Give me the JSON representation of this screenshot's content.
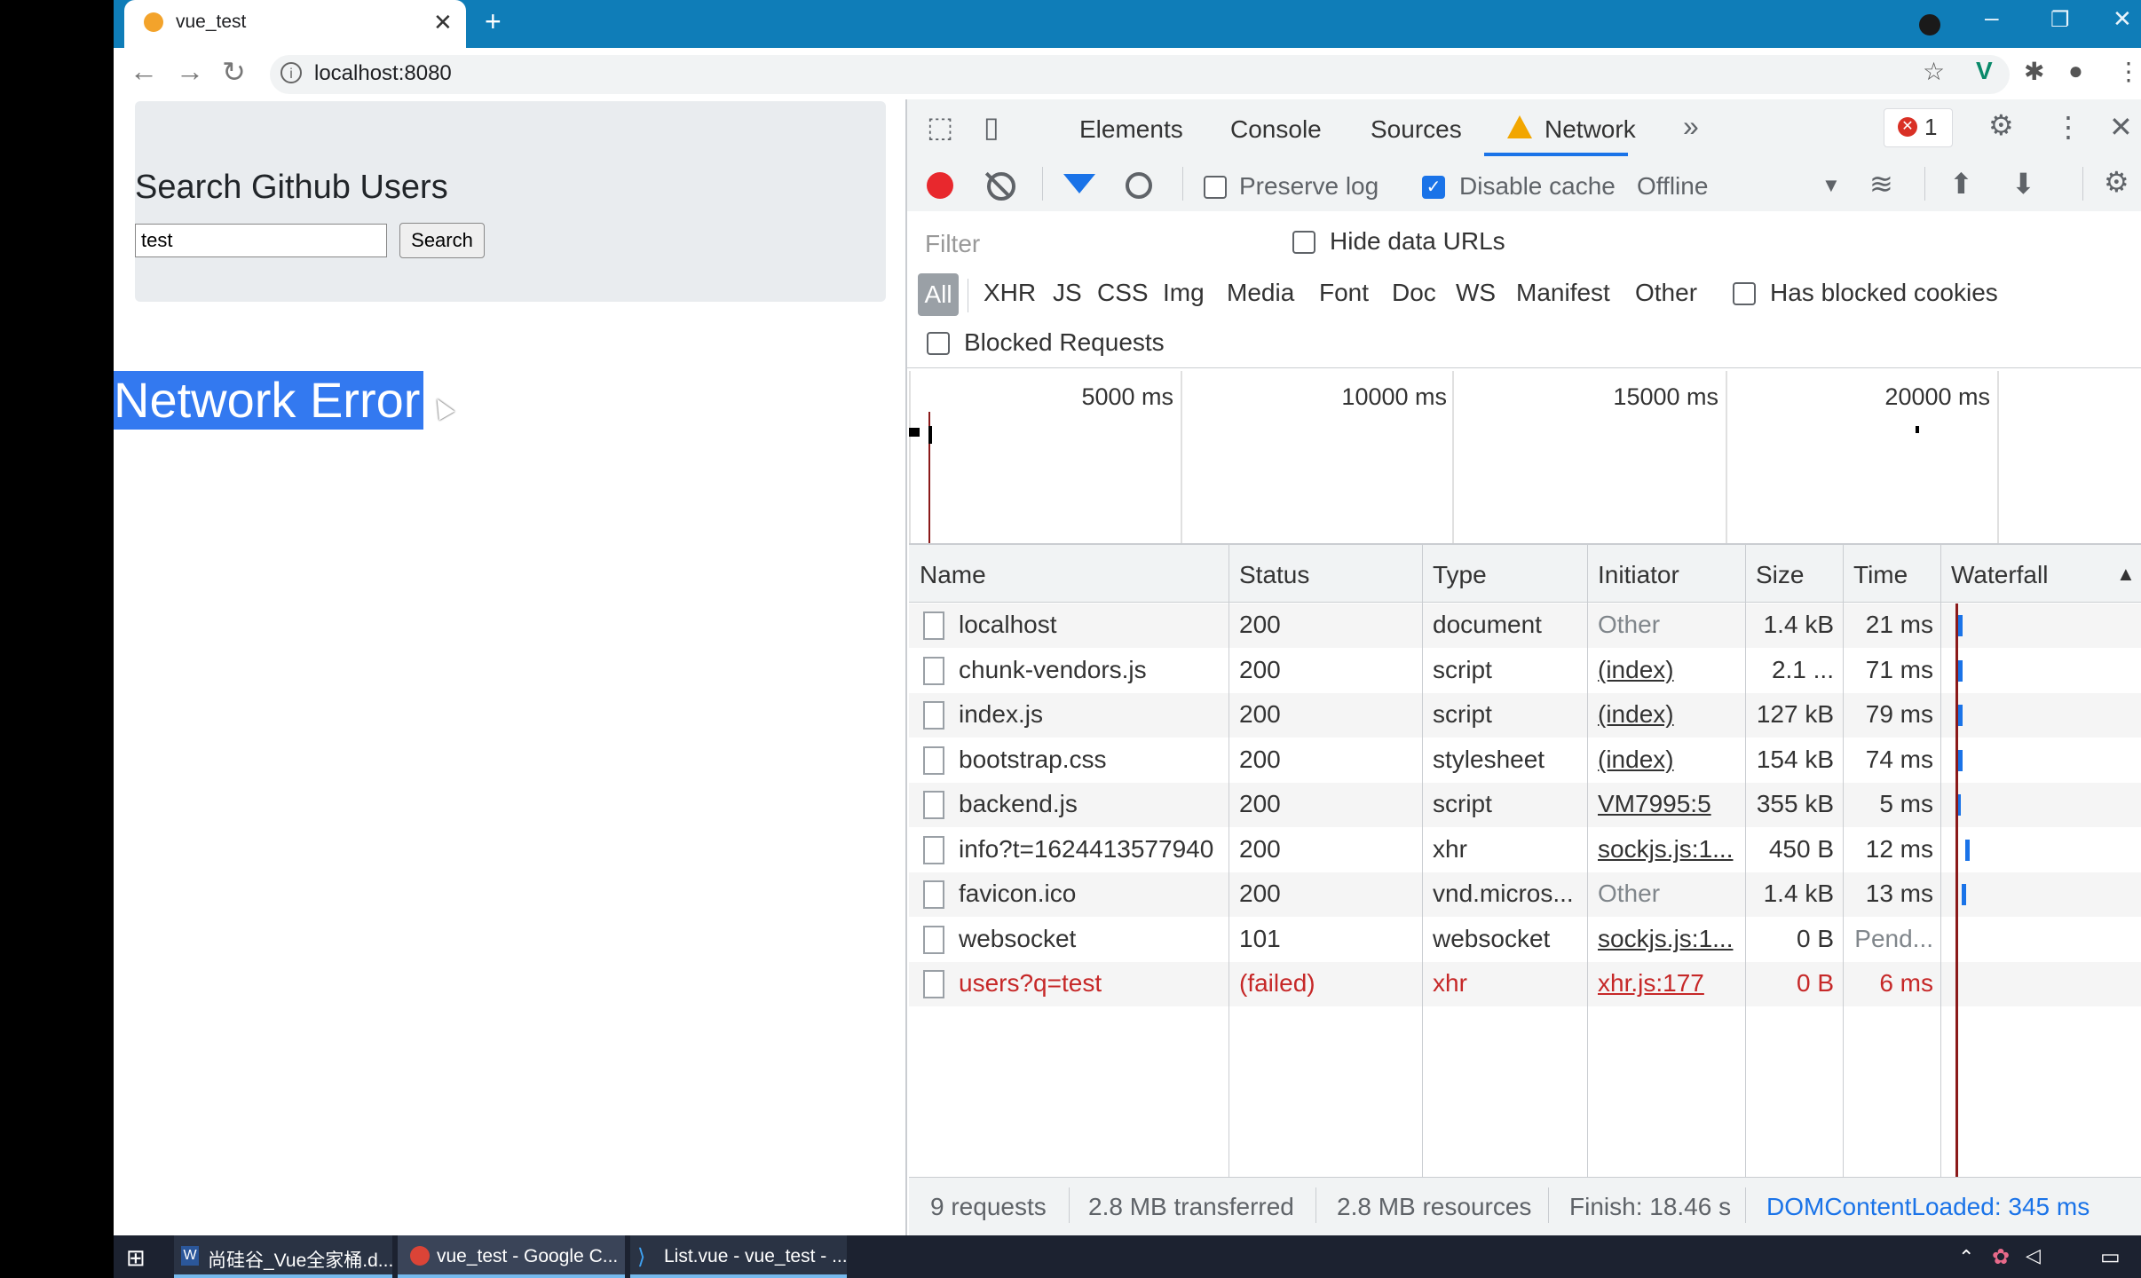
{
  "browser": {
    "tab_title": "vue_test",
    "url": "localhost:8080"
  },
  "page": {
    "heading": "Search Github Users",
    "search_value": "test",
    "search_button": "Search",
    "error_message": "Network Error"
  },
  "devtools": {
    "tabs": [
      "Elements",
      "Console",
      "Sources",
      "Network"
    ],
    "error_count": "1",
    "toolbar": {
      "preserve_log": "Preserve log",
      "preserve_log_checked": false,
      "disable_cache": "Disable cache",
      "disable_cache_checked": true,
      "throttling": "Offline"
    },
    "filter_placeholder": "Filter",
    "hide_data_urls": "Hide data URLs",
    "types": [
      "All",
      "XHR",
      "JS",
      "CSS",
      "Img",
      "Media",
      "Font",
      "Doc",
      "WS",
      "Manifest",
      "Other"
    ],
    "has_blocked_cookies": "Has blocked cookies",
    "blocked_requests": "Blocked Requests",
    "overview_ticks": [
      "5000 ms",
      "10000 ms",
      "15000 ms",
      "20000 ms"
    ],
    "columns": [
      "Name",
      "Status",
      "Type",
      "Initiator",
      "Size",
      "Time",
      "Waterfall"
    ],
    "requests": [
      {
        "name": "localhost",
        "status": "200",
        "type": "document",
        "initiator": "Other",
        "size": "1.4 kB",
        "time": "21 ms",
        "initiator_link": false,
        "failed": false,
        "pending": false
      },
      {
        "name": "chunk-vendors.js",
        "status": "200",
        "type": "script",
        "initiator": "(index)",
        "size": "2.1 ...",
        "time": "71 ms",
        "initiator_link": true,
        "failed": false,
        "pending": false
      },
      {
        "name": "index.js",
        "status": "200",
        "type": "script",
        "initiator": "(index)",
        "size": "127 kB",
        "time": "79 ms",
        "initiator_link": true,
        "failed": false,
        "pending": false
      },
      {
        "name": "bootstrap.css",
        "status": "200",
        "type": "stylesheet",
        "initiator": "(index)",
        "size": "154 kB",
        "time": "74 ms",
        "initiator_link": true,
        "failed": false,
        "pending": false
      },
      {
        "name": "backend.js",
        "status": "200",
        "type": "script",
        "initiator": "VM7995:5",
        "size": "355 kB",
        "time": "5 ms",
        "initiator_link": true,
        "failed": false,
        "pending": false
      },
      {
        "name": "info?t=1624413577940",
        "status": "200",
        "type": "xhr",
        "initiator": "sockjs.js:1...",
        "size": "450 B",
        "time": "12 ms",
        "initiator_link": true,
        "failed": false,
        "pending": false
      },
      {
        "name": "favicon.ico",
        "status": "200",
        "type": "vnd.micros...",
        "initiator": "Other",
        "size": "1.4 kB",
        "time": "13 ms",
        "initiator_link": false,
        "failed": false,
        "pending": false
      },
      {
        "name": "websocket",
        "status": "101",
        "type": "websocket",
        "initiator": "sockjs.js:1...",
        "size": "0 B",
        "time": "Pend...",
        "initiator_link": true,
        "failed": false,
        "pending": true
      },
      {
        "name": "users?q=test",
        "status": "(failed)",
        "type": "xhr",
        "initiator": "xhr.js:177",
        "size": "0 B",
        "time": "6 ms",
        "initiator_link": true,
        "failed": true,
        "pending": false
      }
    ],
    "summary": {
      "requests": "9 requests",
      "transferred": "2.8 MB transferred",
      "resources": "2.8 MB resources",
      "finish": "Finish: 18.46 s",
      "dom_loaded": "DOMContentLoaded: 345 ms",
      "accent": "#1a73e8"
    }
  },
  "taskbar": {
    "items": [
      "尚硅谷_Vue全家桶.d...",
      "vue_test - Google C...",
      "List.vue - vue_test - ..."
    ]
  }
}
